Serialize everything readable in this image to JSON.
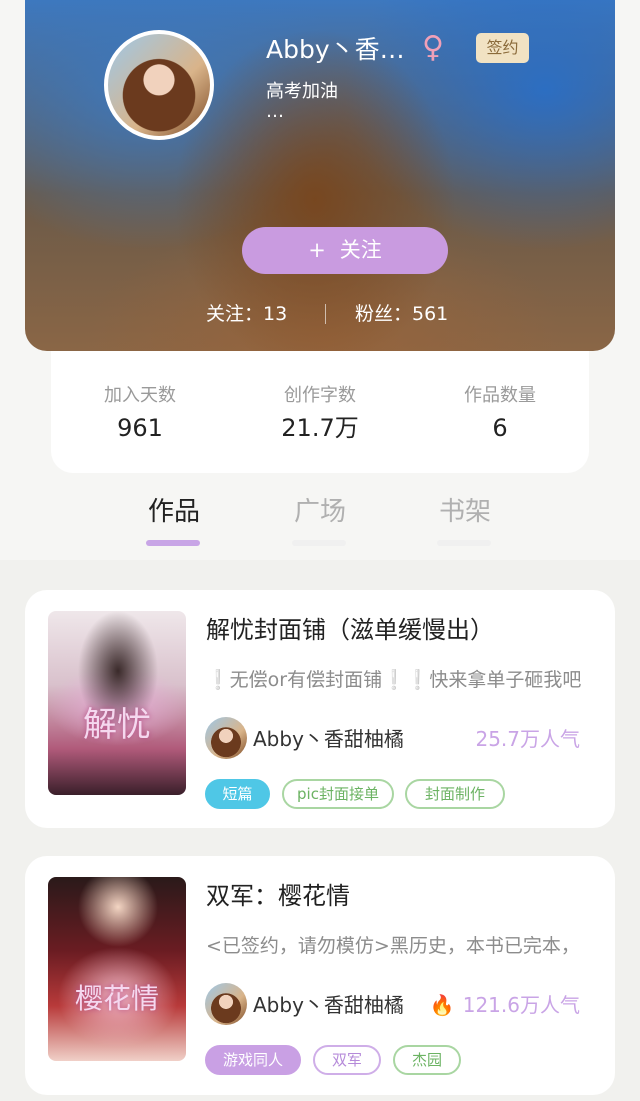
{
  "profile": {
    "nickname": "Abby丶香…",
    "gender_symbol": "♀",
    "signed_badge": "签约",
    "bio": "高考加油",
    "bio_more": "…",
    "follow_button": {
      "plus": "+",
      "label": "关注"
    },
    "following_text": "关注：13",
    "fans_text": "粉丝：561"
  },
  "stats": [
    {
      "label": "加入天数",
      "value": "961"
    },
    {
      "label": "创作字数",
      "value": "21.7万"
    },
    {
      "label": "作品数量",
      "value": "6"
    }
  ],
  "tabs": [
    {
      "label": "作品",
      "active": true
    },
    {
      "label": "广场",
      "active": false
    },
    {
      "label": "书架",
      "active": false
    }
  ],
  "books": [
    {
      "title": "解忧封面铺（滋单缓慢出）",
      "description": "❕无偿or有偿封面铺❕❕快来拿单子砸我吧",
      "author": "Abby丶香甜柚橘",
      "popularity": "25.7万人气",
      "cover_text": "解忧",
      "tags": [
        "短篇",
        "pic封面接单",
        "封面制作"
      ]
    },
    {
      "title": "双军：樱花情",
      "description": "<已签约，请勿模仿>黑历史，本书已完本，",
      "author": "Abby丶香甜柚橘",
      "popularity_icon": "🔥",
      "popularity": "121.6万人气",
      "cover_text": "樱花情",
      "tags": [
        "游戏同人",
        "双军",
        "杰园"
      ]
    }
  ],
  "colors": {
    "accent_purple": "#c99be0",
    "tag_green": "#6cb363",
    "tag_blue": "#4fc7e6",
    "signed_gold": "#f1e2c3"
  }
}
